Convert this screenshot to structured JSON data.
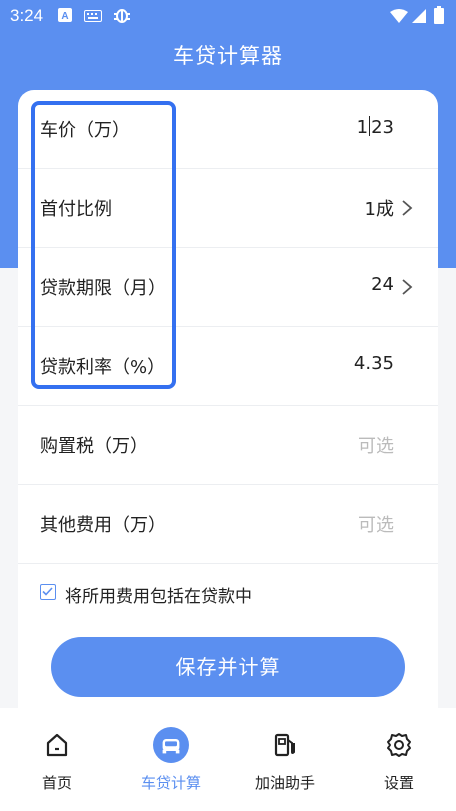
{
  "status_bar": {
    "time": "3:24"
  },
  "app": {
    "title": "车贷计算器"
  },
  "form": {
    "rows": [
      {
        "label": "车价（万）",
        "value": "123"
      },
      {
        "label": "首付比例",
        "value": "1成"
      },
      {
        "label": "贷款期限（月）",
        "value": "24"
      },
      {
        "label": "贷款利率（%）",
        "value": "4.35"
      },
      {
        "label": "购置税（万）",
        "placeholder": "可选"
      },
      {
        "label": "其他费用（万）",
        "placeholder": "可选"
      }
    ],
    "include_fees": {
      "label": "将所用费用包括在贷款中",
      "checked": true
    },
    "save_button": "保存并计算"
  },
  "bottom_nav": {
    "items": [
      {
        "label": "首页",
        "icon": "home-icon"
      },
      {
        "label": "车贷计算",
        "icon": "car-icon",
        "active": true
      },
      {
        "label": "加油助手",
        "icon": "fuel-pump-icon"
      },
      {
        "label": "设置",
        "icon": "gear-icon"
      }
    ]
  },
  "colors": {
    "primary": "#5b8ff0",
    "highlight": "#3470f0",
    "placeholder": "#bbbbbb"
  }
}
